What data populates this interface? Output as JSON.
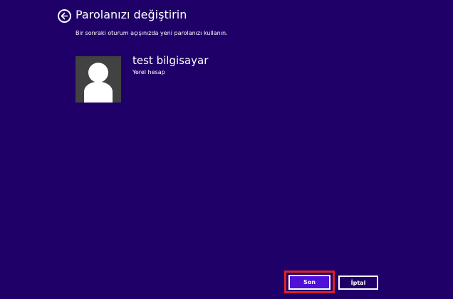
{
  "header": {
    "title": "Parolanızı değiştirin",
    "back_icon": "back-arrow-icon"
  },
  "instructions": "Bir sonraki oturum açışınızda yeni parolanızı kullanın.",
  "user": {
    "avatar_icon": "user-silhouette-icon",
    "name": "test bilgisayar",
    "account_type": "Yerel hesap"
  },
  "buttons": {
    "finish_label": "Son",
    "cancel_label": "İptal"
  },
  "colors": {
    "background": "#1f0068",
    "primary_button": "#4f10d8",
    "highlight": "#e0202a",
    "avatar_background": "#424242"
  }
}
